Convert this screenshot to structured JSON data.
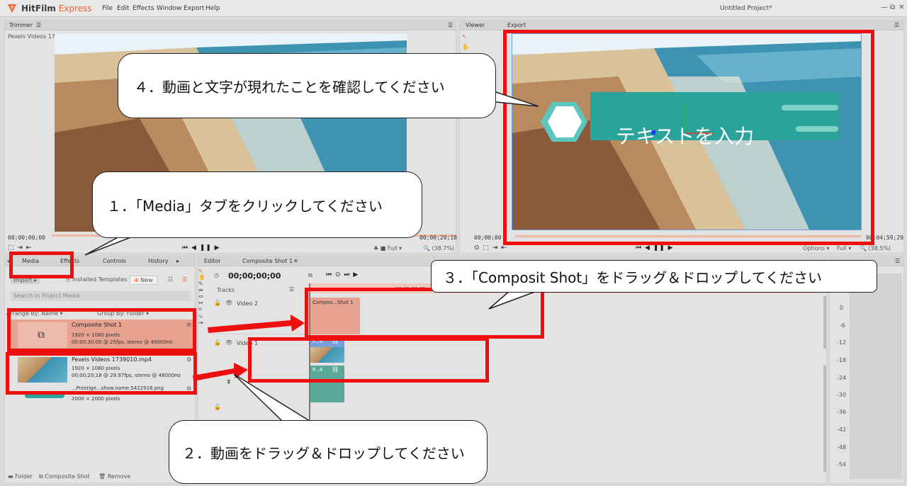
{
  "app": {
    "brand_main": "HitFilm",
    "brand_accent": "Express",
    "project": "Untitled Project*"
  },
  "menu": [
    "File",
    "Edit",
    "Effects",
    "Window",
    "Export",
    "Help"
  ],
  "trimmer": {
    "tab": "Trimmer",
    "filename": "Pexels Videos 1739010.mp4",
    "tc_start": "00;00;00;00",
    "tc_end": "00;00;20;18",
    "quality": "Full",
    "zoom": "(38.7%)"
  },
  "viewer": {
    "tab": "Viewer",
    "tab2": "Export",
    "tc_start": "00;00;00",
    "tc_end": "00;04;59;29",
    "options": "Options",
    "quality": "Full",
    "zoom": "(38.5%)",
    "text_overlay": "テキストを入力"
  },
  "media": {
    "tabs": [
      "Media",
      "Effects",
      "Controls",
      "History"
    ],
    "import": "Import",
    "installed": "Installed Templates",
    "new": "New",
    "search_placeholder": "Search in Project Media",
    "arrange": "Arrange By: Name",
    "group": "Group By: Folder",
    "items": [
      {
        "name": "Composite Shot 1",
        "dims": "1920 × 1080 pixels",
        "info": "00:00:30:00 @ 25fps, stereo @ 48000Hz"
      },
      {
        "name": "Pexels Videos 1739010.mp4",
        "dims": "1920 × 1080 pixels",
        "info": "00;00;20;18 @ 29.97fps, stereo @ 48000Hz"
      },
      {
        "name": "...Prestige...show.name.5422916.png",
        "dims": "2000 × 2000 pixels",
        "info": ""
      }
    ],
    "footer": [
      "Folder",
      "Composite Shot",
      "Remove"
    ]
  },
  "editor": {
    "tabs": [
      "Editor",
      "Composite Shot 1"
    ],
    "timecode": "00;00;00;00",
    "tracks_label": "Tracks",
    "ruler_mark": "00;01;00;02",
    "tracks": [
      "Video 2",
      "Video 1"
    ],
    "clip_composite": "Compos...Shot 1",
    "clip_video": "P...4",
    "clip_audio": "P...4"
  },
  "meter": {
    "labels": [
      "0",
      "-6",
      "-12",
      "-18",
      "-24",
      "-30",
      "-36",
      "-42",
      "-48",
      "-54"
    ]
  },
  "callouts": {
    "step1": "１．「Media」タブをクリックしてください",
    "step2": "２．動画をドラッグ＆ドロップしてください",
    "step3": "３．「Composit Shot」をドラッグ＆ドロップしてください",
    "step4": "４．動画と文字が現れたことを確認してください"
  },
  "colors": {
    "accent": "#e8612c",
    "annotation_red": "#ee0f0f",
    "clip_orange": "#e8a290",
    "clip_teal": "#5aa896"
  }
}
